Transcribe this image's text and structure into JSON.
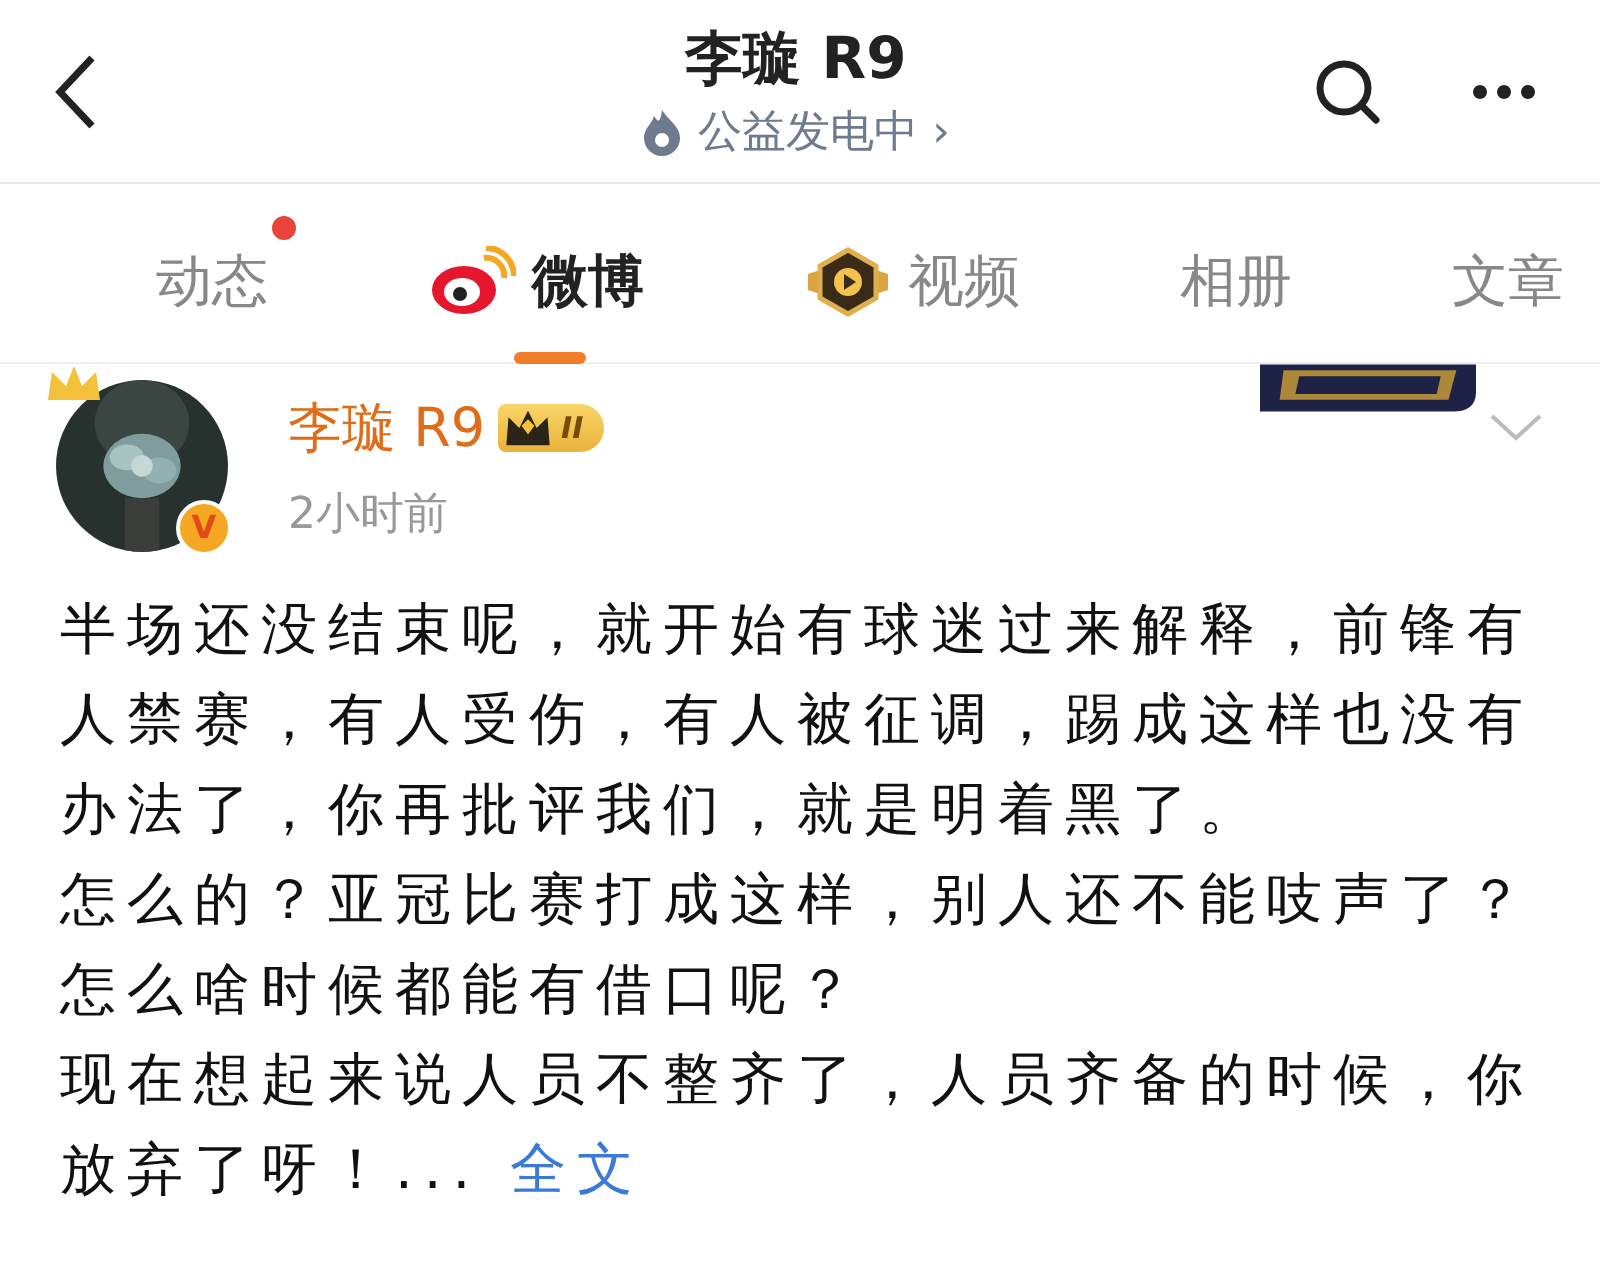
{
  "header": {
    "title": "李璇 R9",
    "subtitle": "公益发电中 ›"
  },
  "tabs": [
    {
      "label": "动态",
      "selected": false,
      "kind": "plain",
      "dot": true
    },
    {
      "label": "微博",
      "selected": true,
      "kind": "weibo",
      "dot": false
    },
    {
      "label": "视频",
      "selected": false,
      "kind": "video",
      "dot": false
    },
    {
      "label": "相册",
      "selected": false,
      "kind": "plain",
      "dot": false
    },
    {
      "label": "文章",
      "selected": false,
      "kind": "plain",
      "dot": false
    }
  ],
  "post": {
    "author": "李璇 R9",
    "level_badge": "II",
    "verified_mark": "V",
    "time": "2小时前",
    "paragraphs": [
      "半场还没结束呢，就开始有球迷过来解释，前锋有人禁赛，有人受伤，有人被征调，踢成这样也没有办法了，你再批评我们，就是明着黑了。",
      "怎么的？亚冠比赛打成这样，别人还不能吱声了？",
      "怎么啥时候都能有借口呢？",
      "现在想起来说人员不整齐了，人员齐备的时候，你放弃了呀！... "
    ],
    "more_link": "全文"
  }
}
